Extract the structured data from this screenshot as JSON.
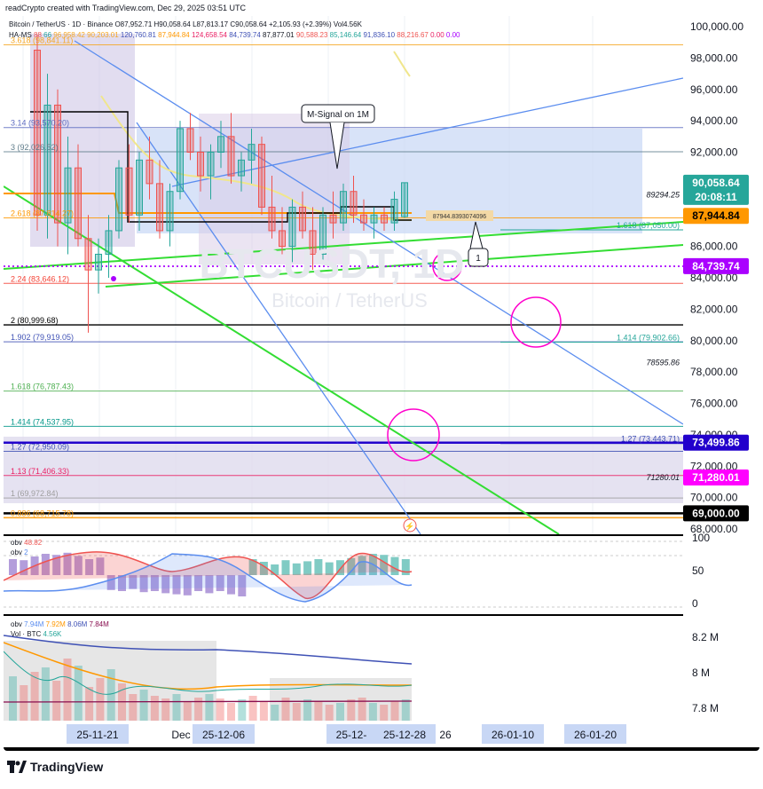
{
  "header": {
    "text": "readCrypto created with TradingView.com, Dec 29, 2025 03:51 UTC"
  },
  "legend": {
    "line1": "Bitcoin / TetherUS · 1D · Binance  O87,952.71 H90,058.64 L87,813.17 C90,058.64 +2,105.93 (+2.39%) Vol4.56K",
    "line2_label": "HA-MS",
    "line2_values": [
      "88",
      "66",
      "96,958.42",
      "90,203.01",
      "120,760.81",
      "87,944.84",
      "124,658.54",
      "84,739.74",
      "87,877.01",
      "90,588.23",
      "85,146.64",
      "91,836.10",
      "88,216.67",
      "0.00",
      "0.00"
    ]
  },
  "watermark": {
    "symbol": "BTCUSDT, 1D",
    "name": "Bitcoin / TetherUS"
  },
  "fib_left": [
    {
      "label": "3.618 (98,841.11)",
      "price": 98841,
      "color": "#f5a623"
    },
    {
      "label": "3.14 (93,570.20)",
      "price": 93570,
      "color": "#5c6bc0"
    },
    {
      "label": "3 (92,026.52)",
      "price": 92026,
      "color": "#607d8b"
    },
    {
      "label": "2.618 (87,814.27)",
      "price": 87814,
      "color": "#ff9800"
    },
    {
      "label": "2.24 (83,646.12)",
      "price": 83646,
      "color": "#f44336"
    },
    {
      "label": "2 (80,999.68)",
      "price": 81000,
      "color": "#000000"
    },
    {
      "label": "1.902 (79,919.05)",
      "price": 79919,
      "color": "#3f51b5"
    },
    {
      "label": "1.618 (76,787.43)",
      "price": 76787,
      "color": "#4caf50"
    },
    {
      "label": "1.414 (74,537.95)",
      "price": 74538,
      "color": "#009688"
    },
    {
      "label": "1.27 (72,950.09)",
      "price": 72950,
      "color": "#3f51b5"
    },
    {
      "label": "1.13 (71,406.33)",
      "price": 71406,
      "color": "#e91e63"
    },
    {
      "label": "1 (69,972.84)",
      "price": 69973,
      "color": "#9e9e9e"
    },
    {
      "label": "0.886 (68,715.78)",
      "price": 68716,
      "color": "#ff9800"
    }
  ],
  "fib_right": [
    {
      "label": "1.618 (87,050.00)",
      "price": 87050,
      "color": "#26a69a"
    },
    {
      "label": "1.414 (79,902.66)",
      "price": 79903,
      "color": "#26a69a"
    },
    {
      "label": "1.27 (73,443.71)",
      "price": 73444,
      "color": "#3f51b5"
    }
  ],
  "right_notes": [
    {
      "label": "89294.25",
      "price": 89294
    },
    {
      "label": "78595.86",
      "price": 78596
    },
    {
      "label": "71280.01",
      "price": 71280
    }
  ],
  "callouts": {
    "msignal": "M-Signal on 1M",
    "price_box": "87944.8393074096",
    "marker": "1"
  },
  "price_axis": {
    "ticks": [
      "100,000.00",
      "98,000.00",
      "96,000.00",
      "94,000.00",
      "92,000.00",
      "90,000.00",
      "88,000.00",
      "86,000.00",
      "84,000.00",
      "82,000.00",
      "80,000.00",
      "78,000.00",
      "76,000.00",
      "74,000.00",
      "72,000.00",
      "70,000.00",
      "68,000.00"
    ],
    "tick_values": [
      100000,
      98000,
      96000,
      94000,
      92000,
      90000,
      88000,
      86000,
      84000,
      82000,
      80000,
      78000,
      76000,
      74000,
      72000,
      70000,
      68000
    ],
    "badges": [
      {
        "label": "90,058.64",
        "sub": "20:08:11",
        "price": 90058,
        "bg": "#26a69a",
        "fg": "#ffffff"
      },
      {
        "label": "87,944.84",
        "price": 87944,
        "bg": "#ff9800",
        "fg": "#000000"
      },
      {
        "label": "84,739.74",
        "price": 84739,
        "bg": "#aa00ff",
        "fg": "#ffffff"
      },
      {
        "label": "73,499.86",
        "price": 73500,
        "bg": "#2200cc",
        "fg": "#ffffff"
      },
      {
        "label": "71,280.01",
        "price": 71280,
        "bg": "#ff00ff",
        "fg": "#ffffff"
      },
      {
        "label": "69,000.00",
        "price": 69000,
        "bg": "#000000",
        "fg": "#ffffff"
      }
    ]
  },
  "osc1": {
    "legend1": "obv",
    "legend1_value": "48.82",
    "legend2": "obv",
    "legend2_value": "2",
    "ticks": [
      "100",
      "50",
      "0"
    ]
  },
  "osc2": {
    "legend1": "obv",
    "legend1_values": [
      "7.94M",
      "7.92M",
      "8.06M",
      "7.84M"
    ],
    "legend2": "Vol · BTC",
    "legend2_value": "4.56K",
    "ticks": [
      "8.2 M",
      "8 M",
      "7.8 M"
    ]
  },
  "time_axis": {
    "labels": [
      {
        "text": "25-11-21",
        "highlight": true
      },
      {
        "text": "Dec",
        "highlight": false
      },
      {
        "text": "25-12-06",
        "highlight": true
      },
      {
        "text": "25-12-",
        "highlight": true
      },
      {
        "text": "25-12-28",
        "highlight": true
      },
      {
        "text": "26",
        "highlight": false
      },
      {
        "text": "26-01-10",
        "highlight": true
      },
      {
        "text": "26-01-20",
        "highlight": true
      }
    ]
  },
  "footer": {
    "brand": "TradingView"
  },
  "colors": {
    "up": "#26a69a",
    "down": "#ef5350",
    "background": "#ffffff",
    "highlight": "#c8d7f5"
  }
}
